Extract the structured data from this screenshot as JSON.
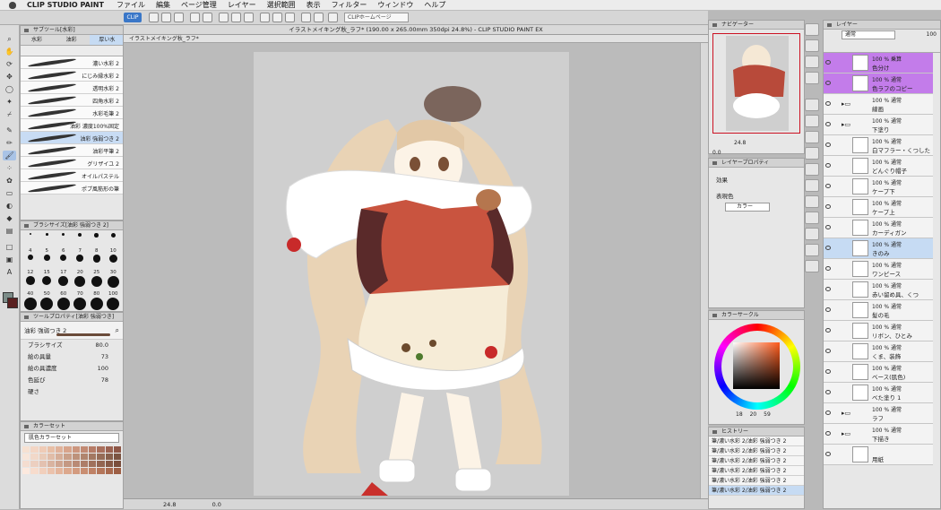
{
  "menubar": {
    "app": "CLIP STUDIO PAINT",
    "items": [
      "ファイル",
      "編集",
      "ページ管理",
      "レイヤー",
      "選択範囲",
      "表示",
      "フィルター",
      "ウィンドウ",
      "ヘルプ"
    ]
  },
  "command_bar": {
    "clip_label": "CLIP",
    "page_button": "CLIPホームページ"
  },
  "sub_tool": {
    "header": "サブツール[水彩]",
    "tabs": [
      "水彩",
      "油彩",
      "厚い水"
    ],
    "brushes": [
      "濃い水彩 2",
      "にじみ縁水彩 2",
      "透明水彩 2",
      "四角水彩 2",
      "水彩毛筆 2",
      "油彩 濃度100%固定",
      "油彩 強弱つき 2",
      "油彩平筆 2",
      "グリザイユ 2",
      "オイルパステル",
      "ポプ風筋形の筆"
    ],
    "selected_index": 6
  },
  "brush_size": {
    "header": "ブラシサイズ[油彩 強弱つき 2]",
    "sizes": [
      "4",
      "5",
      "6",
      "7",
      "8",
      "10",
      "12",
      "15",
      "17",
      "20",
      "25",
      "30",
      "40",
      "50",
      "60",
      "70",
      "80",
      "100",
      "120",
      "150",
      "170",
      "200",
      "250",
      "300"
    ]
  },
  "tool_property": {
    "header": "ツールプロパティ[油彩 強弱つき]",
    "brush_name": "油彩 強弱つき 2",
    "rows": [
      {
        "label": "ブラシサイズ",
        "value": "80.0"
      },
      {
        "label": "絵の具量",
        "value": "73"
      },
      {
        "label": "絵の具濃度",
        "value": "100"
      },
      {
        "label": "色延び",
        "value": "78"
      },
      {
        "label": "硬さ",
        "value": ""
      }
    ]
  },
  "color_set": {
    "header": "カラーセット",
    "set_name": "肌色カラーセット",
    "colors": [
      "#f6e1d2",
      "#f3d6c5",
      "#efcbb6",
      "#e8bfa6",
      "#e0b29a",
      "#d8a48b",
      "#cc967e",
      "#c28a73",
      "#b67c67",
      "#a96f5c",
      "#9b6251",
      "#8d5646",
      "#f8e6da",
      "#f1d8c9",
      "#e9cbb8",
      "#e1bda8",
      "#d6ae98",
      "#caa089",
      "#bd927b",
      "#b0856e",
      "#a37862",
      "#966c57",
      "#88604c",
      "#7b5442",
      "#f4ddd0",
      "#eccfc0",
      "#e3c1b0",
      "#d9b3a0",
      "#cfa591",
      "#c49883",
      "#b98a75",
      "#ad7d68",
      "#a0715c",
      "#936551",
      "#865946",
      "#7a4e3c",
      "#fce9de",
      "#f7dccd",
      "#f1cfbc",
      "#ebc2ac",
      "#e4b59c",
      "#dca88d",
      "#d39b7f",
      "#c98e72",
      "#bf8266",
      "#b4765a",
      "#a96a4f",
      "#9d5f45"
    ]
  },
  "canvas": {
    "doc_title": "イラストメイキング秋_ラフ* (190.00 x 265.00mm 350dpi 24.8%) - CLIP STUDIO PAINT EX",
    "tab_label": "イラストメイキング秋_ラフ*",
    "zoom": "24.8",
    "rotation": "0.0"
  },
  "navigator": {
    "header": "ナビゲーター",
    "zoom": "24.8",
    "rotation": "0.0"
  },
  "layer_property": {
    "header": "レイヤープロパティ",
    "effect_label": "効果",
    "display_color_label": "表現色",
    "display_color_value": "カラー"
  },
  "color_circle": {
    "header": "カラーサークル",
    "h": "18",
    "s": "20",
    "v": "59"
  },
  "history": {
    "header": "ヒストリー",
    "items": [
      "筆/濃い水彩 2/油彩 強弱つき 2",
      "筆/濃い水彩 2/油彩 強弱つき 2",
      "筆/濃い水彩 2/油彩 強弱つき 2",
      "筆/濃い水彩 2/油彩 強弱つき 2",
      "筆/濃い水彩 2/油彩 強弱つき 2",
      "筆/濃い水彩 2/油彩 強弱つき 2"
    ]
  },
  "layers": {
    "header": "レイヤー",
    "blend_mode": "通常",
    "opacity": "100",
    "items": [
      {
        "mode": "100 % 乗算",
        "name": "色分け",
        "color": "purple"
      },
      {
        "mode": "100 % 通常",
        "name": "色ラフのコピー",
        "color": "purple"
      },
      {
        "mode": "100 % 通常",
        "name": "線画",
        "folder": true
      },
      {
        "mode": "100 % 通常",
        "name": "下塗り",
        "folder": true
      },
      {
        "mode": "100 % 通常",
        "name": "白マフラー・くつした"
      },
      {
        "mode": "100 % 通常",
        "name": "どんぐり帽子"
      },
      {
        "mode": "100 % 通常",
        "name": "ケープ下"
      },
      {
        "mode": "100 % 通常",
        "name": "ケープ上"
      },
      {
        "mode": "100 % 通常",
        "name": "カーディガン"
      },
      {
        "mode": "100 % 通常",
        "name": "きのみ",
        "selected": true
      },
      {
        "mode": "100 % 通常",
        "name": "ワンピース"
      },
      {
        "mode": "100 % 通常",
        "name": "赤い留め具、くつ"
      },
      {
        "mode": "100 % 通常",
        "name": "髪の毛"
      },
      {
        "mode": "100 % 通常",
        "name": "リボン、ひとみ"
      },
      {
        "mode": "100 % 通常",
        "name": "くま、装飾"
      },
      {
        "mode": "100 % 通常",
        "name": "ベース(肌色)"
      },
      {
        "mode": "100 % 通常",
        "name": "べた塗り 1"
      },
      {
        "mode": "100 % 通常",
        "name": "ラフ",
        "folder": true
      },
      {
        "mode": "100 % 通常",
        "name": "下描き",
        "folder": true
      },
      {
        "mode": "",
        "name": "用紙"
      }
    ]
  }
}
